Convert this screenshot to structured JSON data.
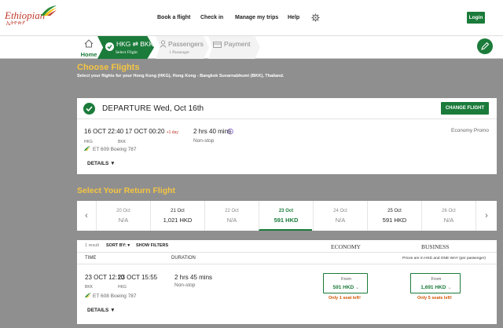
{
  "logo": {
    "word": "Ethiopian",
    "amharic": "ኢትዮጵያ"
  },
  "nav": {
    "book": "Book a flight",
    "checkin": "Check in",
    "manage": "Manage my trips",
    "help": "Help",
    "login": "Login"
  },
  "steps": {
    "home": "Home",
    "active_title": "HKG ⇄ BKK",
    "active_sub": "Select Flight",
    "passengers": "Passengers",
    "passengers_sub": "1 Passenger",
    "payment": "Payment"
  },
  "page": {
    "title": "Choose Flights",
    "subtitle": "Select your flights for your Hong Kong (HKG), Hong Kong - Bangkok Suvarnabhumi (BKK), Thailand."
  },
  "departure": {
    "label": "DEPARTURE",
    "date": "Wed, Oct 16th",
    "change_btn": "CHANGE FLIGHT",
    "dep_time": "16 OCT 22:40",
    "arr_time": "17 OCT 00:20",
    "nextday": "+1 day",
    "from_code": "HKG",
    "to_code": "BKK",
    "flight": "ET 609  Boeing 787",
    "duration": "2 hrs 40 mins",
    "stops": "Non-stop",
    "cabin": "Economy Promo",
    "details": "DETAILS"
  },
  "return_title": "Select Your Return Flight",
  "dates": [
    {
      "date": "20 Oct",
      "price": "N/A",
      "has": false
    },
    {
      "date": "21 Oct",
      "price": "1,021 HKD",
      "has": true
    },
    {
      "date": "22 Oct",
      "price": "N/A",
      "has": false
    },
    {
      "date": "23 Oct",
      "price": "591 HKD",
      "has": true,
      "selected": true
    },
    {
      "date": "24 Oct",
      "price": "N/A",
      "has": false
    },
    {
      "date": "25 Oct",
      "price": "591 HKD",
      "has": true
    },
    {
      "date": "26 Oct",
      "price": "N/A",
      "has": false
    }
  ],
  "results": {
    "count": "1 result",
    "sortby": "SORT BY:",
    "show_filters": "SHOW FILTERS",
    "economy": "ECONOMY",
    "business": "BUSINESS",
    "time_head": "TIME",
    "duration_head": "DURATION",
    "price_note": "Prices are in HKD and ONE WAY (per passenger)",
    "flight": {
      "dep_time": "23 OCT 12:10",
      "arr_time": "23 OCT 15:55",
      "from_code": "BKK",
      "to_code": "HKG",
      "flight": "ET 608  Boeing 787",
      "duration": "2 hrs 45 mins",
      "stops": "Non-stop",
      "econ_from": "From",
      "econ_price": "591 HKD",
      "econ_seats": "Only 1 seat left!",
      "bus_from": "From",
      "bus_price": "1,691 HKD",
      "bus_seats": "Only 5 seats left!",
      "details": "DETAILS"
    }
  },
  "colors": {
    "brand_green": "#1b7b3a",
    "accent_yellow": "#f5c542",
    "alert_orange": "#d35400"
  }
}
